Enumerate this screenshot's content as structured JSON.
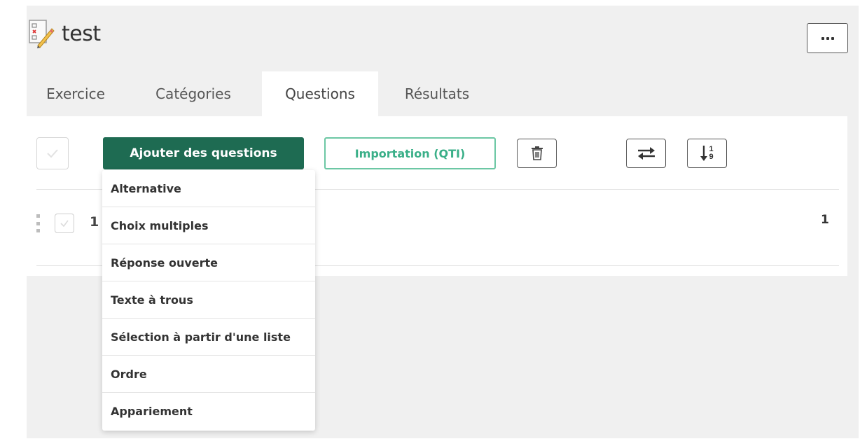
{
  "header": {
    "title": "test",
    "doc_icon": "exercise-doc-icon",
    "more_icon": "ellipsis-icon"
  },
  "tabs": [
    {
      "label": "Exercice",
      "active": false
    },
    {
      "label": "Catégories",
      "active": false
    },
    {
      "label": "Questions",
      "active": true
    },
    {
      "label": "Résultats",
      "active": false
    }
  ],
  "toolbar": {
    "add_label": "Ajouter des questions",
    "import_label": "Importation (QTI)",
    "trash_icon": "trash-icon",
    "swap_icon": "swap-arrows-icon",
    "sort_icon": "sort-numeric-icon",
    "sort_top": "1",
    "sort_bottom": "9"
  },
  "question_row": {
    "number": "1",
    "count": "1"
  },
  "add_menu": {
    "items": [
      "Alternative",
      "Choix multiples",
      "Réponse ouverte",
      "Texte à trous",
      "Sélection à partir d'une liste",
      "Ordre",
      "Appariement"
    ]
  },
  "colors": {
    "primary": "#1e6b52",
    "accent": "#6cc7a4",
    "panel_bg": "#f0f0f0"
  }
}
